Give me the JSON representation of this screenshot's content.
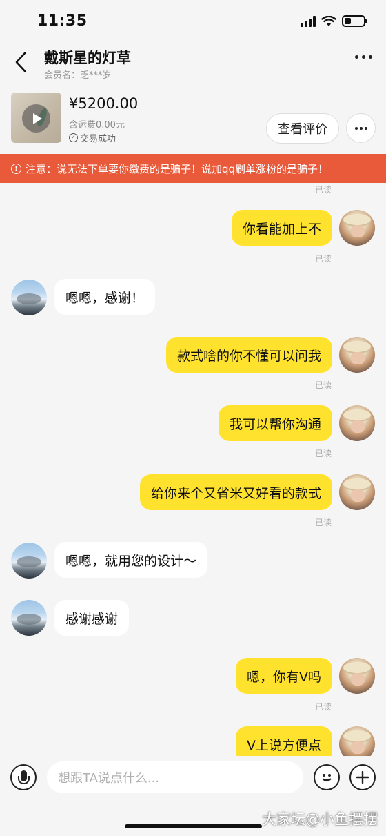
{
  "status_bar": {
    "time": "11:35",
    "battery_level": 0.35
  },
  "header": {
    "title": "戴斯星的灯草",
    "subtitle": "会员名：乏***岁"
  },
  "product": {
    "price": "¥5200.00",
    "shipping": "含运费0.00元",
    "status": "交易成功",
    "review_button": "查看评价"
  },
  "warning": {
    "text": "注意：说无法下单要你缴费的是骗子！说加qq刷单涨粉的是骗子！"
  },
  "chat": {
    "read_label": "已读",
    "messages": [
      {
        "sender": "me",
        "text": "你看能加上不",
        "read": true
      },
      {
        "sender": "them",
        "text": "嗯嗯，感谢！",
        "read": false
      },
      {
        "sender": "me",
        "text": "款式啥的你不懂可以问我",
        "read": true
      },
      {
        "sender": "me",
        "text": "我可以帮你沟通",
        "read": true
      },
      {
        "sender": "me",
        "text": "给你来个又省米又好看的款式",
        "read": true
      },
      {
        "sender": "them",
        "text": "嗯嗯，就用您的设计～",
        "read": false
      },
      {
        "sender": "them",
        "text": "感谢感谢",
        "read": false
      },
      {
        "sender": "me",
        "text": "嗯，你有V吗",
        "read": true
      },
      {
        "sender": "me",
        "text": "V上说方便点",
        "read": false
      }
    ]
  },
  "input_bar": {
    "placeholder": "想跟TA说点什么..."
  },
  "watermark": "大家坛@小鱼摆摆"
}
